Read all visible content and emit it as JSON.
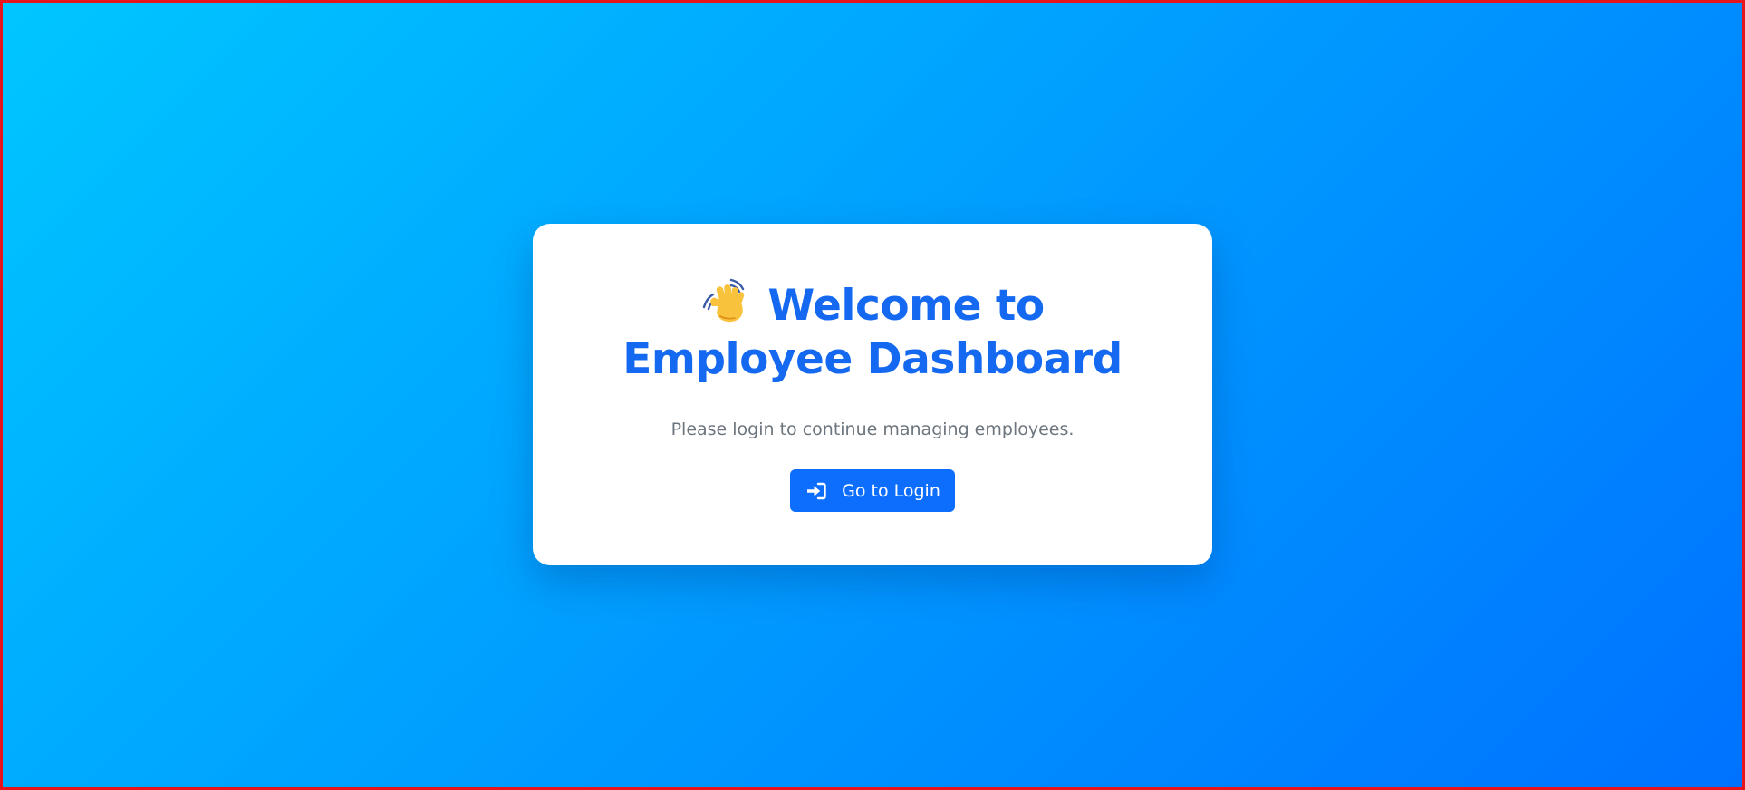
{
  "page": {
    "background_colors": [
      "#00c6ff",
      "#0072ff"
    ],
    "border_color": "#e8141c"
  },
  "card": {
    "title_icon": "waving-hand-icon",
    "title": "Welcome to Employee Dashboard",
    "subtitle": "Please login to continue managing employees.",
    "title_color": "#1469f0"
  },
  "login_button": {
    "icon": "sign-in-icon",
    "label": "Go to Login",
    "color": "#0d6efd"
  }
}
